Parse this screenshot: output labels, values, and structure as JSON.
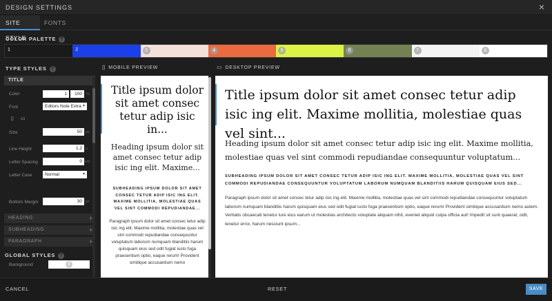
{
  "window": {
    "title": "DESIGN SETTINGS",
    "close_glyph": "×"
  },
  "tabs": [
    {
      "label": "SITE STYLE",
      "active": true
    },
    {
      "label": "FONTS",
      "active": false
    }
  ],
  "color_palette": {
    "label": "COLOR PALETTE",
    "help": "?",
    "swatches": [
      {
        "num": "1",
        "color": "#1a1a1a"
      },
      {
        "num": "2",
        "color": "#1b3fe8"
      },
      {
        "num": "3",
        "color": "#f4dfd9"
      },
      {
        "num": "4",
        "color": "#ec6a40"
      },
      {
        "num": "5",
        "color": "#dcf246"
      },
      {
        "num": "6",
        "color": "#748153"
      },
      {
        "num": "7",
        "color": "#f4f4f4"
      },
      {
        "num": "8",
        "color": "#ffffff"
      }
    ]
  },
  "type_styles": {
    "label": "TYPE STYLES",
    "help": "?",
    "title_group": {
      "label": "TITLE",
      "color_label": "Color",
      "color_value": "1",
      "opacity_value": "100",
      "opacity_unit": "%",
      "font_label": "Font",
      "font_value": "Editors Note Extra",
      "size_label": "Size",
      "size_value": "50",
      "size_unit": "px",
      "line_height_label": "Line Height",
      "line_height_value": "1.2",
      "line_height_unit": "u",
      "letter_spacing_label": "Letter Spacing",
      "letter_spacing_value": "0",
      "letter_spacing_unit": "em",
      "letter_case_label": "Letter Case",
      "letter_case_value": "Normal",
      "bottom_margin_label": "Bottom Margin",
      "bottom_margin_value": "30",
      "bottom_margin_unit": "px"
    },
    "collapsed_groups": [
      {
        "label": "HEADING",
        "plus": "+"
      },
      {
        "label": "SUBHEADING",
        "plus": "+"
      },
      {
        "label": "PARAGRAPH",
        "plus": "+"
      }
    ]
  },
  "global_styles": {
    "label": "GLOBAL STYLES",
    "help": "?",
    "background_label": "Background",
    "background_value": "8"
  },
  "mobile_preview": {
    "label": "MOBILE PREVIEW",
    "title": "Title ipsum dolor sit amet consec tetur adip isic in...",
    "heading": "Heading ipsum dolor sit amet consec tetur adip isic ing elit. Maxime...",
    "subheading": "SUBHEADING IPSUM DOLOR SIT AMET CONSEC TETUR ADIP ISIC ING ELIT. MAXIME MOLLITIA, MOLESTIAE QUAS VEL SINT COMMODI REPUDIANDAE...",
    "paragraph": "Paragraph ipsum dolor sit amet consec tetur adip isic ing elit. Maxime mollitia, molestiae quas vel sint commodi repudiandae consequuntur voluptatum laborum numquam blanditiis harum quisquam eius sed odit fugiat iusto fuga praesentium optio, eaque rerum! Provident similique accusantium nemo"
  },
  "desktop_preview": {
    "label": "DESKTOP PREVIEW",
    "title": "Title ipsum dolor sit amet consec tetur adip isic ing elit. Maxime mollitia, molestiae quas vel sint...",
    "heading": "Heading ipsum dolor sit amet consec tetur adip isic ing elit. Maxime mollitia, molestiae quas vel sint commodi repudiandae consequuntur voluptatum...",
    "subheading": "SUBHEADING IPSUM DOLOR SIT AMET CONSEC TETUR ADIP ISIC ING ELIT. MAXIME MOLLITIA, MOLESTIAE QUAS VEL SINT COMMODI REPUDIANDAE CONSEQUUNTUR VOLUPTATUM LABORUM NUMQUAM BLANDITIIS HARUM QUISQUAM EIUS SED...",
    "paragraph": "Paragraph ipsum dolor sit amet consec tetur adip isic ing elit. Maxime mollitia, molestiae quas vel sint commodi repudiandae consequuntur voluptatum laborum numquam blanditiis harum quisquam eius sed odit fugiat iusto fuga praesentium optio, eaque rerum! Provident similique accusantium nemo autem. Veritatis obcaecati tenetur iure eius earum ut molestias architecto voluptate aliquam nihil, eveniet aliquid culpa officia aut! Impedit sit sunt quaerat, odit, tenetur error, harum nesciunt ipsum..."
  },
  "footer": {
    "cancel": "CANCEL",
    "reset": "RESET",
    "save": "SAVE"
  },
  "colors": {
    "accent": "#4a90d9",
    "save_button": "#4a8cc4"
  }
}
